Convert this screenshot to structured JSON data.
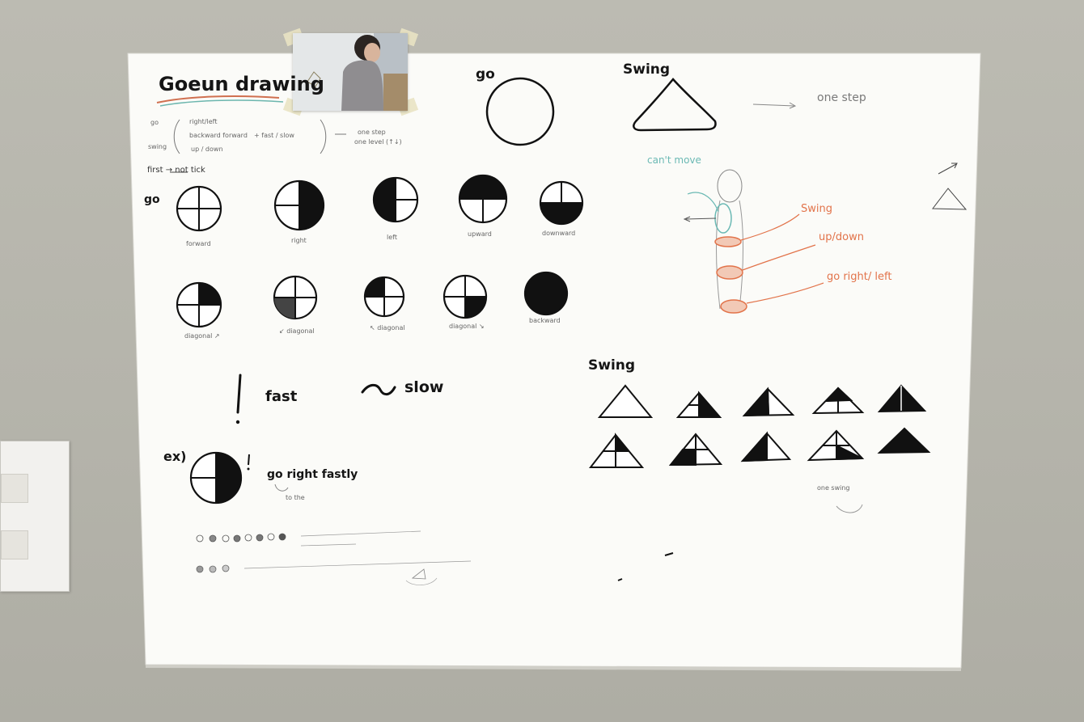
{
  "title": "Goeun drawing",
  "legend_lines": {
    "left": [
      "go",
      "swing"
    ],
    "options": [
      "right/left",
      "backward forward",
      "up / down"
    ],
    "plus": "+ fast / slow",
    "result": [
      "one step",
      "one level (↑↓)"
    ]
  },
  "first_note": "first → not tick",
  "go_label": "go",
  "swing_label": "Swing",
  "one_step": "one step",
  "go_row1": [
    "forward",
    "right",
    "left",
    "upward",
    "downward"
  ],
  "go_row2": [
    "diagonal ↗",
    "↙ diagonal",
    "↖ diagonal",
    "diagonal ↘",
    "backward"
  ],
  "speed": {
    "fast_mark": "!",
    "fast": "fast",
    "slow_mark": "~",
    "slow": "slow"
  },
  "example": {
    "label": "ex)",
    "mark": "!",
    "text": "go right fastly",
    "sub": "to the"
  },
  "figure_labels": {
    "cant_move": "can't move",
    "swing": "Swing",
    "up_down": "up/down",
    "go_right_left": "go right/ left"
  },
  "swing_section": {
    "title": "Swing",
    "caption": "one swing"
  },
  "colors": {
    "ink": "#141414",
    "orange_marker": "#e2734a",
    "teal_marker": "#6bb9b4",
    "board": "#fbfbf8",
    "wall": "#b8b7ae"
  }
}
